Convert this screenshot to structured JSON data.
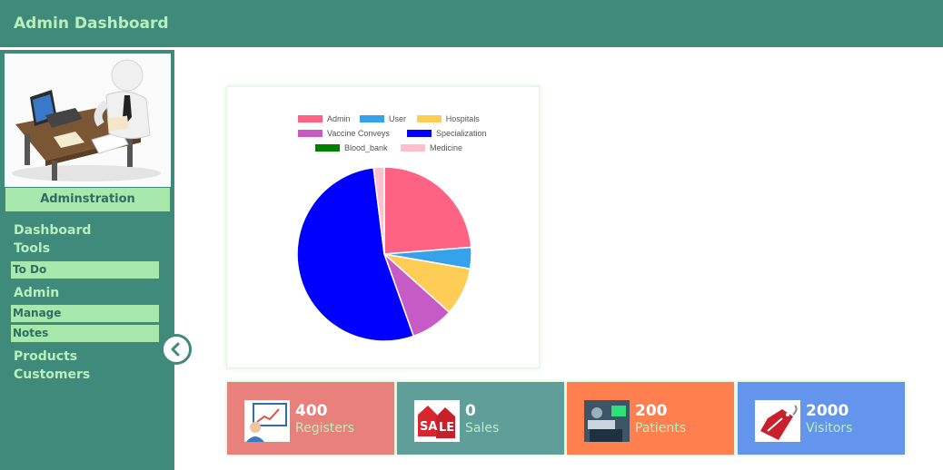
{
  "header": {
    "title": "Admin Dashboard"
  },
  "sidebar": {
    "role_label": "Adminstration",
    "nav": [
      {
        "label": "Dashboard",
        "type": "heading"
      },
      {
        "label": "Tools",
        "type": "heading"
      },
      {
        "label": "To Do",
        "type": "item"
      },
      {
        "label": "Admin",
        "type": "heading"
      },
      {
        "label": "Manage",
        "type": "item"
      },
      {
        "label": "Notes",
        "type": "item"
      },
      {
        "label": "Products",
        "type": "heading"
      },
      {
        "label": "Customers",
        "type": "heading"
      }
    ],
    "collapse_icon": "chevron-left-icon"
  },
  "chart_data": {
    "type": "pie",
    "legend_position": "top",
    "categories": [
      "Admin",
      "User",
      "Hospitals",
      "Vaccine Conveys",
      "Specialization",
      "Blood_bank",
      "Medicine"
    ],
    "values": [
      24,
      4,
      9,
      8,
      54,
      0,
      2
    ],
    "colors": [
      "#ff6384",
      "#36a2eb",
      "#ffcd56",
      "#c65bc6",
      "#0000ff",
      "#008000",
      "#ffc0cb"
    ]
  },
  "stats": [
    {
      "value": "400",
      "label": "Registers",
      "color": "#e8807c",
      "icon": "presentation-chart-icon"
    },
    {
      "value": "0",
      "label": "Sales",
      "color": "#5f9e99",
      "icon": "sale-tag-icon"
    },
    {
      "value": "200",
      "label": "Patients",
      "color": "#ff7f4f",
      "icon": "hospital-room-icon"
    },
    {
      "value": "2000",
      "label": "Visitors",
      "color": "#6495ed",
      "icon": "visitor-tag-icon"
    }
  ]
}
